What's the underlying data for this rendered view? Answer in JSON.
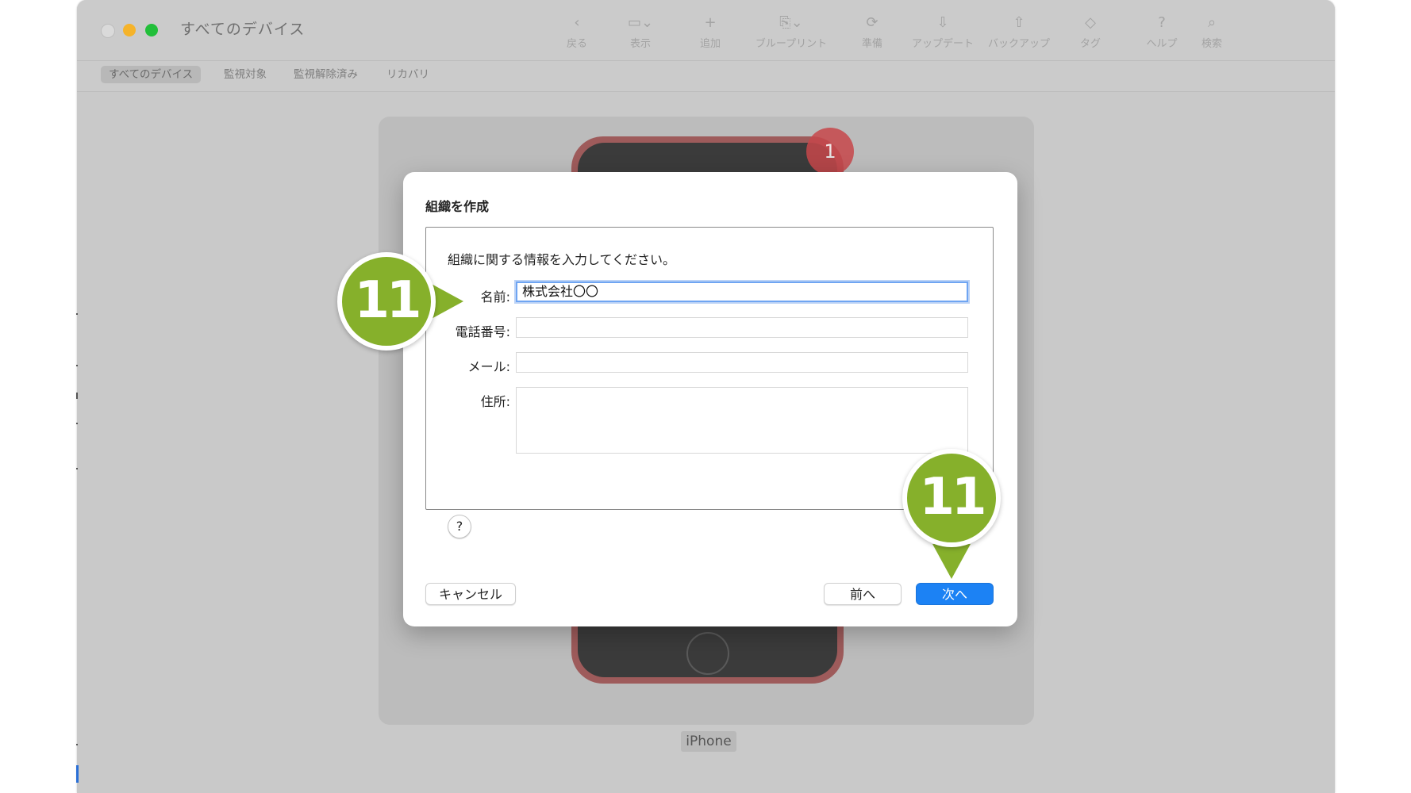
{
  "window": {
    "title": "すべてのデバイス"
  },
  "toolbar": {
    "items": [
      {
        "label": "戻る",
        "icon": "chevron-left-icon",
        "glyph": "‹"
      },
      {
        "label": "表示",
        "icon": "view-icon",
        "glyph": "▭⌄"
      },
      {
        "label": "追加",
        "icon": "plus-icon",
        "glyph": "+"
      },
      {
        "label": "ブループリント",
        "icon": "blueprint-icon",
        "glyph": "⎘⌄"
      },
      {
        "label": "準備",
        "icon": "prepare-icon",
        "glyph": "⟳"
      },
      {
        "label": "アップデート",
        "icon": "update-icon",
        "glyph": "⇩"
      },
      {
        "label": "バックアップ",
        "icon": "backup-icon",
        "glyph": "⇧"
      },
      {
        "label": "タグ",
        "icon": "tag-icon",
        "glyph": "◇"
      },
      {
        "label": "ヘルプ",
        "icon": "help-icon",
        "glyph": "?"
      },
      {
        "label": "検索",
        "icon": "search-icon",
        "glyph": "⌕"
      }
    ]
  },
  "tabs": [
    "すべてのデバイス",
    "監視対象",
    "監視解除済み",
    "リカバリ"
  ],
  "device": {
    "name": "iPhone",
    "badge": "1"
  },
  "dialog": {
    "title": "組織を作成",
    "instruction": "組織に関する情報を入力してください。",
    "fields": {
      "name": {
        "label": "名前:",
        "value": "株式会社〇〇"
      },
      "phone": {
        "label": "電話番号:",
        "value": ""
      },
      "email": {
        "label": "メール:",
        "value": ""
      },
      "address": {
        "label": "住所:",
        "value": ""
      }
    },
    "help": "?",
    "buttons": {
      "cancel": "キャンセル",
      "back": "前へ",
      "next": "次へ"
    }
  },
  "callouts": {
    "name_step": "11",
    "next_step": "11"
  },
  "colors": {
    "callout": "#86b02b",
    "primary_button": "#1c82f4",
    "badge": "#c7474b"
  }
}
